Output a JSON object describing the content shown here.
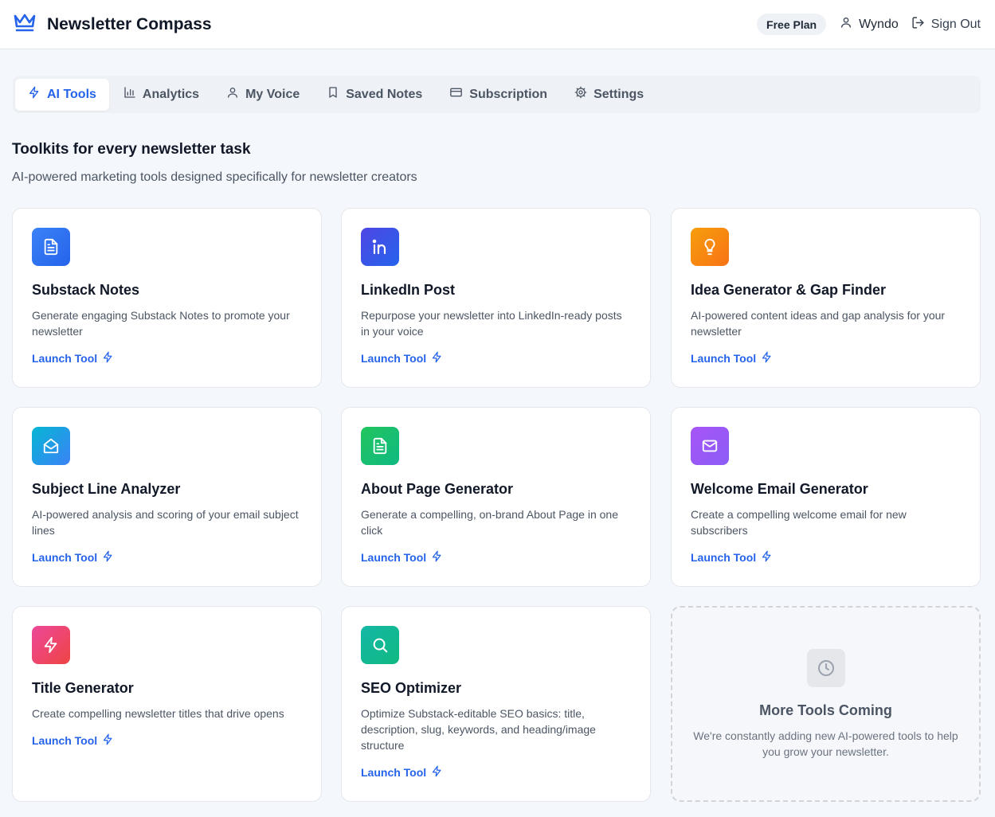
{
  "header": {
    "brand_icon": "crown-icon",
    "app_title": "Newsletter Compass",
    "plan_badge": "Free Plan",
    "user_name": "Wyndo",
    "sign_out": "Sign Out"
  },
  "tabs": [
    {
      "label": "AI Tools",
      "icon": "zap-icon",
      "active": true
    },
    {
      "label": "Analytics",
      "icon": "bar-chart-icon",
      "active": false
    },
    {
      "label": "My Voice",
      "icon": "user-icon",
      "active": false
    },
    {
      "label": "Saved Notes",
      "icon": "bookmark-icon",
      "active": false
    },
    {
      "label": "Subscription",
      "icon": "credit-card-icon",
      "active": false
    },
    {
      "label": "Settings",
      "icon": "gear-icon",
      "active": false
    }
  ],
  "main": {
    "heading": "Toolkits for every newsletter task",
    "subheading": "AI-powered marketing tools designed specifically for newsletter creators"
  },
  "tools": [
    {
      "title": "Substack Notes",
      "description": "Generate engaging Substack Notes to promote your newsletter",
      "launch_label": "Launch Tool",
      "icon": "document-icon",
      "color_from": "#3b82f6",
      "color_to": "#2563eb"
    },
    {
      "title": "LinkedIn Post",
      "description": "Repurpose your newsletter into LinkedIn-ready posts in your voice",
      "launch_label": "Launch Tool",
      "icon": "linkedin-icon",
      "color_from": "#4f46e5",
      "color_to": "#2563eb"
    },
    {
      "title": "Idea Generator & Gap Finder",
      "description": "AI-powered content ideas and gap analysis for your newsletter",
      "launch_label": "Launch Tool",
      "icon": "lightbulb-icon",
      "color_from": "#f59e0b",
      "color_to": "#f97316"
    },
    {
      "title": "Subject Line Analyzer",
      "description": "AI-powered analysis and scoring of your email subject lines",
      "launch_label": "Launch Tool",
      "icon": "mail-open-icon",
      "color_from": "#06b6d4",
      "color_to": "#3b82f6"
    },
    {
      "title": "About Page Generator",
      "description": "Generate a compelling, on-brand About Page in one click",
      "launch_label": "Launch Tool",
      "icon": "document-icon",
      "color_from": "#22c55e",
      "color_to": "#10b981"
    },
    {
      "title": "Welcome Email Generator",
      "description": "Create a compelling welcome email for new subscribers",
      "launch_label": "Launch Tool",
      "icon": "mail-icon",
      "color_from": "#a855f7",
      "color_to": "#8b5cf6"
    },
    {
      "title": "Title Generator",
      "description": "Create compelling newsletter titles that drive opens",
      "launch_label": "Launch Tool",
      "icon": "zap-icon",
      "color_from": "#ec4899",
      "color_to": "#ef4444"
    },
    {
      "title": "SEO Optimizer",
      "description": "Optimize Substack-editable SEO basics: title, description, slug, keywords, and heading/image structure",
      "launch_label": "Launch Tool",
      "icon": "search-icon",
      "color_from": "#14b8a6",
      "color_to": "#10b981"
    }
  ],
  "coming_soon": {
    "icon": "clock-icon",
    "title": "More Tools Coming",
    "description": "We're constantly adding new AI-powered tools to help you grow your newsletter."
  },
  "colors": {
    "accent": "#2563eb",
    "page_bg": "#f4f7fb"
  }
}
